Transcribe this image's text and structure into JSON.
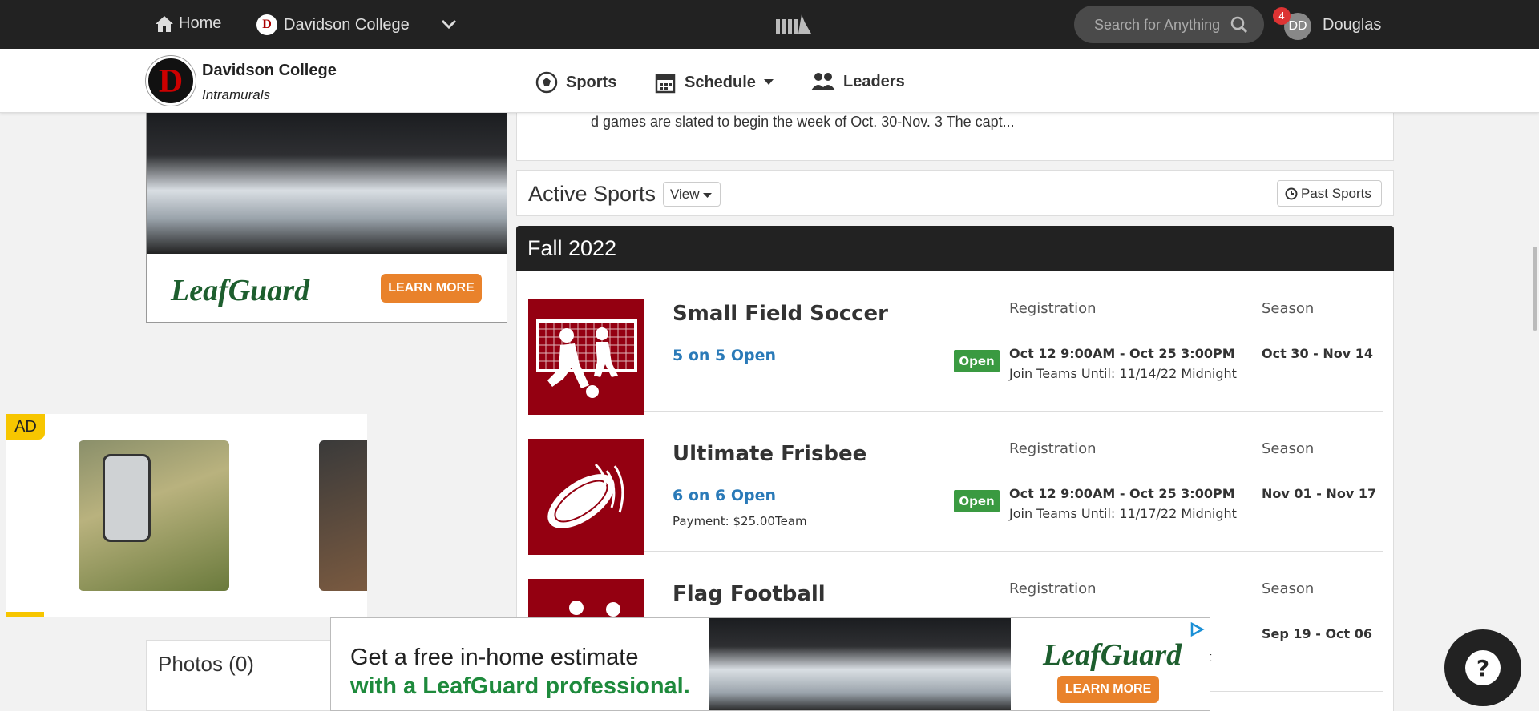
{
  "topbar": {
    "home_label": "Home",
    "school_label": "Davidson College",
    "search_placeholder": "Search for Anything",
    "notification_count": "4",
    "avatar_initials": "DD",
    "user_name": "Douglas"
  },
  "header": {
    "org_name": "Davidson College",
    "org_sub": "Intramurals",
    "nav": {
      "sports": "Sports",
      "schedule": "Schedule",
      "leaders": "Leaders"
    }
  },
  "news": {
    "excerpt": "d games are slated to begin the week of Oct. 30-Nov. 3 The capt..."
  },
  "active_sports": {
    "title": "Active Sports",
    "view_label": "View",
    "past_label": "Past Sports",
    "season_title": "Fall 2022"
  },
  "sports": [
    {
      "name": "Small Field Soccer",
      "division": "5 on 5 Open",
      "payment": "",
      "status": "Open",
      "reg_label": "Registration",
      "reg_dates": "Oct 12 9:00AM - Oct 25 3:00PM",
      "join": "Join Teams Until: 11/14/22 Midnight",
      "season_label": "Season",
      "season_dates": "Oct 30 - Nov 14"
    },
    {
      "name": "Ultimate Frisbee",
      "division": "6 on 6 Open",
      "payment": "Payment: $25.00Team",
      "status": "Open",
      "reg_label": "Registration",
      "reg_dates": "Oct 12 9:00AM - Oct 25 3:00PM",
      "join": "Join Teams Until: 11/17/22 Midnight",
      "season_label": "Season",
      "season_dates": "Nov 01 - Nov 17"
    },
    {
      "name": "Flag Football",
      "division": "",
      "payment": "",
      "status": "",
      "reg_label": "Registration",
      "reg_dates": "",
      "join": "ght",
      "season_label": "Season",
      "season_dates": "Sep 19 - Oct 06"
    }
  ],
  "left_ad": {
    "brand": "LeafGuard",
    "cta": "LEARN MORE"
  },
  "side_ad": {
    "label": "AD"
  },
  "photos": {
    "title": "Photos (0)"
  },
  "bottom_ad": {
    "line1": "Get a free in-home estimate",
    "line2": "with a LeafGuard professional.",
    "brand": "LeafGuard",
    "cta": "LEARN MORE"
  },
  "colors": {
    "accent": "#940011",
    "link": "#2a7ab8",
    "open": "#3a9a41",
    "topbar": "#222222"
  }
}
